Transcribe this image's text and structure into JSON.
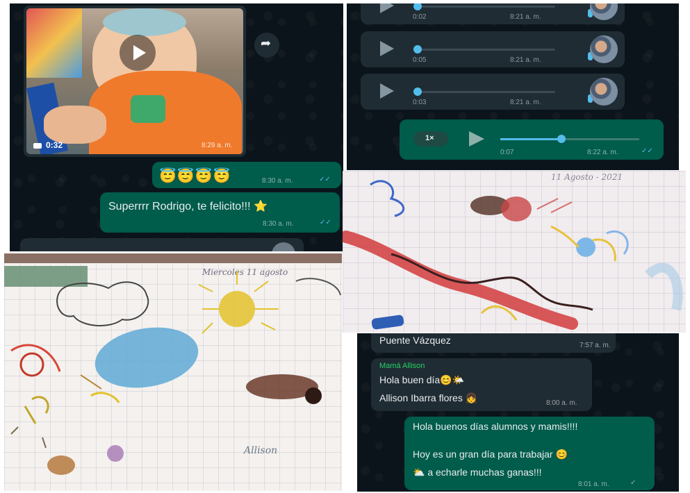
{
  "video_panel": {
    "duration": "0:32",
    "time": "8:29 a. m.",
    "emoji_time": "8:30 a. m.",
    "message": "Superrrr Rodrigo, te felicito!!! ⭐",
    "message_time": "8:30 a. m."
  },
  "audio_panel": {
    "messages": [
      {
        "duration": "0:02",
        "time": "8:21 a. m."
      },
      {
        "duration": "0:05",
        "time": "8:21 a. m."
      },
      {
        "duration": "0:03",
        "time": "8:21 a. m."
      }
    ],
    "sent_audio": {
      "speed": "1×",
      "duration": "0:07",
      "time": "8:22 a. m."
    }
  },
  "drawing_top_right": {
    "date_text": "11 Agosto - 2021"
  },
  "drawing_bottom_left": {
    "header_text": "Miercoles 11 agosto",
    "signature": "Allison"
  },
  "chat_bottom": {
    "partial_message": "Puente Vázquez",
    "partial_time": "7:57 a. m.",
    "incoming": {
      "sender": "Mamá Allison",
      "line1": "Hola buen día😊🌤️",
      "line2": "Allison Ibarra flores 👧",
      "time": "8:00 a. m."
    },
    "outgoing": {
      "line1": "Hola buenos días alumnos y mamis!!!!",
      "line2": "Hoy es un gran día para trabajar 😊",
      "line3": "⛅ a echarle muchas ganas!!!",
      "time": "8:01 a. m."
    }
  },
  "colors": {
    "bubble_out": "#005c4b",
    "bubble_in": "#202c33",
    "chat_bg": "#0b141a",
    "tick_blue": "#53bdeb"
  }
}
